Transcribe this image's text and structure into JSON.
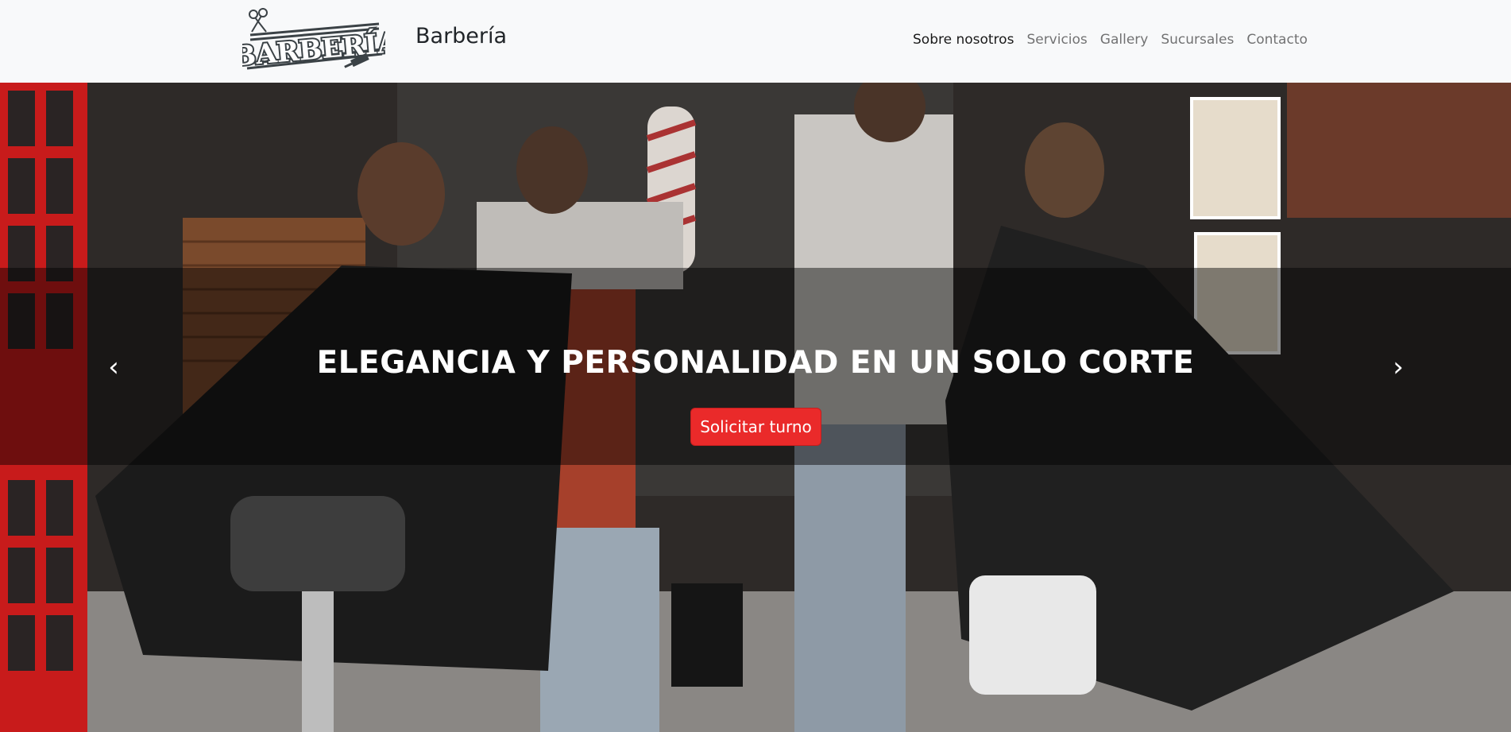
{
  "header": {
    "logo_text": "BARBERÍA",
    "brand": "Barbería",
    "nav": [
      {
        "label": "Sobre nosotros",
        "active": true
      },
      {
        "label": "Servicios",
        "active": false
      },
      {
        "label": "Gallery",
        "active": false
      },
      {
        "label": "Sucursales",
        "active": false
      },
      {
        "label": "Contacto",
        "active": false
      }
    ]
  },
  "hero": {
    "title": "ELEGANCIA Y PERSONALIDAD EN UN SOLO CORTE",
    "cta_label": "Solicitar turno",
    "prev_icon": "‹",
    "next_icon": "›"
  },
  "colors": {
    "accent": "#ea2a2a",
    "navbar_bg": "#f8f9fa",
    "nav_active": "#212529",
    "nav_inactive": "#6c6c6c"
  }
}
